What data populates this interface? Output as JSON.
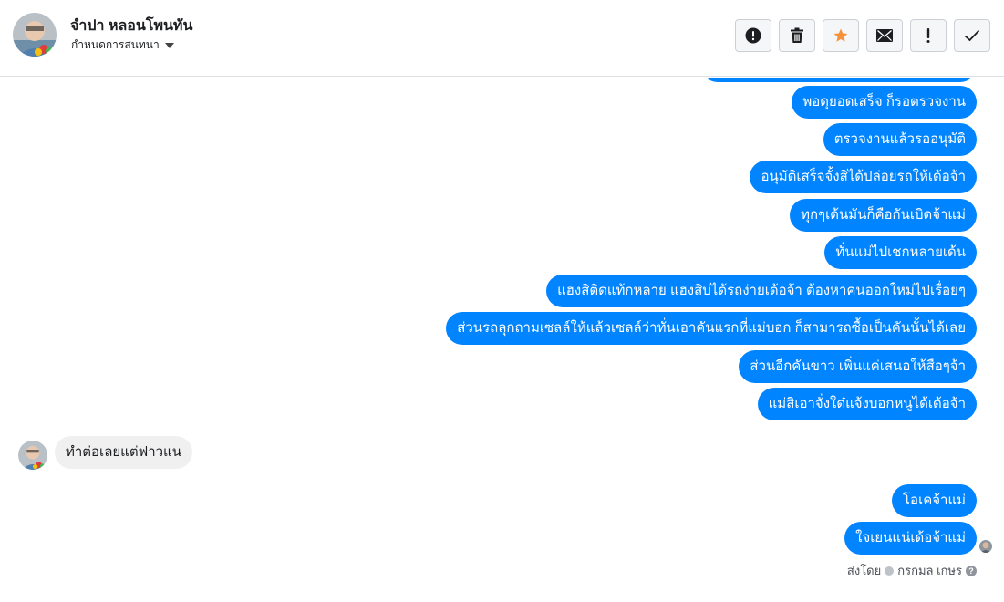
{
  "header": {
    "contact_name": "จำปา หลอนโพนทัน",
    "assign_label": "กำหนดการสนทนา"
  },
  "toolbar": [
    {
      "icon": "alert-circle-icon",
      "name": "spam-button"
    },
    {
      "icon": "trash-icon",
      "name": "delete-button"
    },
    {
      "icon": "star-icon",
      "name": "star-button",
      "color": "#f7923b"
    },
    {
      "icon": "envelope-icon",
      "name": "mark-unread-button"
    },
    {
      "icon": "exclamation-icon",
      "name": "follow-up-button"
    },
    {
      "icon": "check-icon",
      "name": "mark-done-button"
    }
  ],
  "messages": {
    "outgoing": [
      "พอดุยอดเสร็จ ก็รอตรวจงาน",
      "ตรวจงานแล้วรออนุมัติ",
      "อนุมัติเสร็จจั้งสิได้ปล่อยรถให้เด้อจ้า",
      "ทุกๆเด้นมันก็คือกันเบิดจ้าแม่",
      "ทั่นแม่ไปเชกหลายเด้น",
      "แฮงสิติดแท้กหลาย แฮงสิบ่ได้รถง่ายเด้อจ้า  ต้องหาคนออกใหม่ไปเรื่อยๆ",
      "ส่วนรถลุกถามเซลล์ให้แล้วเซลล์ว่าทั่นเอาคันแรกที่แม่บอก  ก็สามารถซื้อเป็นคันนั้นได้เลย",
      "ส่วนอีกคันขาว เพิ่นแค่เสนอให้สือๆจ้า",
      "แม่สิเอาจั่งใด๋แจ้งบอกหนูได้เด้อจ้า"
    ],
    "incoming": "ทำต่อเลยแต่ฟาวแน",
    "outgoing_after": [
      "โอเคจ้าแม่",
      "ใจเยนแน่เด้อจ้าแม่"
    ]
  },
  "sent_by": {
    "prefix": "ส่งโดย",
    "name": "กรกมล เกษร"
  },
  "colors": {
    "outgoing_bubble": "#0084ff",
    "incoming_bubble": "#f1f0f0",
    "star": "#f7923b"
  }
}
